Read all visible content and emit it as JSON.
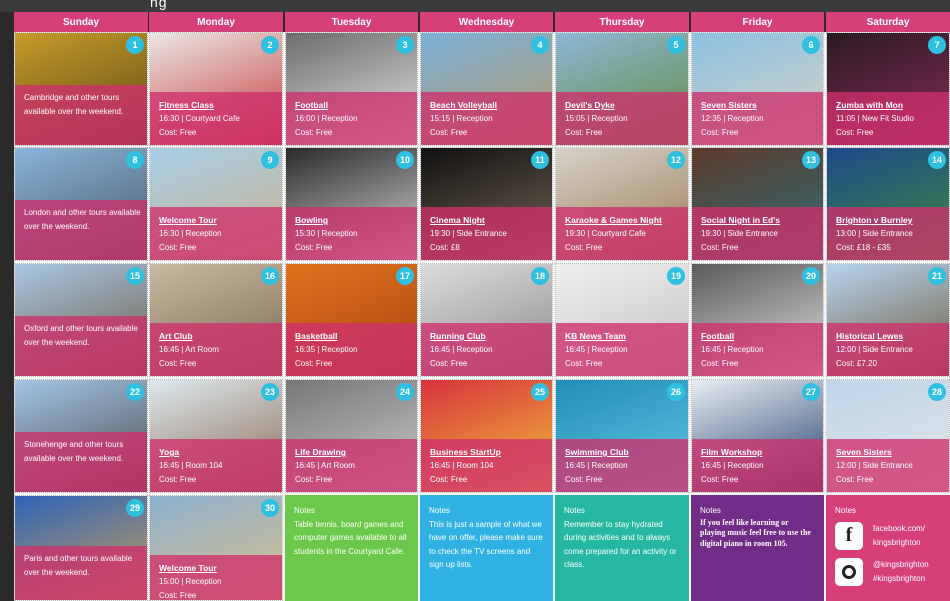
{
  "window_title": "ng",
  "days": [
    "Sunday",
    "Monday",
    "Tuesday",
    "Wednesday",
    "Thursday",
    "Friday",
    "Saturday"
  ],
  "rows": [
    [
      {
        "num": "1",
        "type": "tour",
        "text": "Cambridge and other tours available over the weekend."
      },
      {
        "num": "2",
        "type": "event",
        "title": "Fitness Class",
        "line": "16:30 | Courtyard Cafe",
        "cost": "Cost: Free"
      },
      {
        "num": "3",
        "type": "event",
        "title": "Football",
        "line": "16:00 | Reception",
        "cost": "Cost: Free"
      },
      {
        "num": "4",
        "type": "event",
        "title": "Beach Volleyball",
        "line": "15:15 | Reception",
        "cost": "Cost: Free"
      },
      {
        "num": "5",
        "type": "event",
        "title": "Devil's Dyke",
        "line": "15:05 | Reception",
        "cost": "Cost: Free"
      },
      {
        "num": "6",
        "type": "event",
        "title": "Seven Sisters",
        "line": "12:35 | Reception",
        "cost": "Cost: Free"
      },
      {
        "num": "7",
        "type": "event",
        "title": "Zumba with Mon",
        "line": "11:05 | New Fit Studio",
        "cost": "Cost: Free"
      }
    ],
    [
      {
        "num": "8",
        "type": "tour",
        "text": "London and other tours available over the weekend."
      },
      {
        "num": "9",
        "type": "event",
        "title": "Welcome Tour",
        "line": "16:30 | Reception",
        "cost": "Cost: Free"
      },
      {
        "num": "10",
        "type": "event",
        "title": "Bowling",
        "line": "15:30 | Reception",
        "cost": "Cost: Free"
      },
      {
        "num": "11",
        "type": "event",
        "title": "Cinema Night",
        "line": "19:30 | Side Entrance",
        "cost": "Cost: £8"
      },
      {
        "num": "12",
        "type": "event",
        "title": "Karaoke & Games Night",
        "line": "19:30 | Courtyard Cafe",
        "cost": "Cost: Free"
      },
      {
        "num": "13",
        "type": "event",
        "title": "Social Night in Ed's",
        "line": "19:30 | Side Entrance",
        "cost": "Cost: Free"
      },
      {
        "num": "14",
        "type": "event",
        "title": "Brighton v Burnley",
        "line": "13:00 | Side Entrance",
        "cost": "Cost: £18 - £35"
      }
    ],
    [
      {
        "num": "15",
        "type": "tour",
        "text": "Oxford and other tours available over the weekend."
      },
      {
        "num": "16",
        "type": "event",
        "title": "Art Club",
        "line": "16:45 | Art Room",
        "cost": "Cost: Free"
      },
      {
        "num": "17",
        "type": "event",
        "title": "Basketball",
        "line": "16:35 | Reception",
        "cost": "Cost: Free"
      },
      {
        "num": "18",
        "type": "event",
        "title": "Running Club",
        "line": "16:45 | Reception",
        "cost": "Cost: Free"
      },
      {
        "num": "19",
        "type": "event",
        "title": "KB News Team",
        "line": "16:45 | Reception",
        "cost": "Cost: Free"
      },
      {
        "num": "20",
        "type": "event",
        "title": "Football",
        "line": "16:45 | Reception",
        "cost": "Cost: Free"
      },
      {
        "num": "21",
        "type": "event",
        "title": "Historical Lewes",
        "line": "12:00 | Side Entrance",
        "cost": "Cost: £7.20"
      }
    ],
    [
      {
        "num": "22",
        "type": "tour",
        "text": "Stonehenge and other tours available over the weekend."
      },
      {
        "num": "23",
        "type": "event",
        "title": "Yoga",
        "line": "16:45 | Room 104",
        "cost": "Cost: Free"
      },
      {
        "num": "24",
        "type": "event",
        "title": "Life Drawing",
        "line": "16:45 | Art Room",
        "cost": "Cost: Free"
      },
      {
        "num": "25",
        "type": "event",
        "title": "Business StartUp",
        "line": "16:45 | Room 104",
        "cost": "Cost: Free"
      },
      {
        "num": "26",
        "type": "event",
        "title": "Swimming Club",
        "line": "16:45 | Reception",
        "cost": "Cost: Free"
      },
      {
        "num": "27",
        "type": "event",
        "title": "Film Workshop",
        "line": "16:45 | Reception",
        "cost": "Cost: Free"
      },
      {
        "num": "28",
        "type": "event",
        "title": "Seven Sisters",
        "line": "12:00 | Side Entrance",
        "cost": "Cost: Free"
      }
    ]
  ],
  "last_row": {
    "sun": {
      "num": "29",
      "text": "Paris and other tours available over the weekend."
    },
    "mon": {
      "num": "30",
      "title": "Welcome Tour",
      "line": "15:00 | Reception",
      "cost": "Cost: Free"
    },
    "notes": [
      {
        "heading": "Notes",
        "text": "Table tennis, board games and computer games available to all students in the Courtyard Cafe.",
        "color": "#6bc84a"
      },
      {
        "heading": "Notes",
        "text": "This is just a sample of what we have on offer, please make sure to check the TV screens and sign up lists.",
        "color": "#2fb2e3"
      },
      {
        "heading": "Notes",
        "text": "Remember to stay hydrated during activities and to always come prepared for an activity or class.",
        "color": "#26b7a1"
      },
      {
        "heading": "Notes",
        "text": "If you feel like learning or playing music feel free to use the digital piano in room 105.",
        "color": "#702c86"
      }
    ],
    "social": {
      "heading": "Notes",
      "facebook": "facebook.com/ kingsbrighton",
      "instagram": "@kingsbrighton #kingsbrighton",
      "color": "#d63f78"
    }
  },
  "colors": {
    "header": "#d63f78",
    "badge": "#2fc0e0",
    "overlay": "#ce306c"
  },
  "image_palettes": [
    [
      "#c79a2a",
      "#5b4a12"
    ],
    [
      "#e9e6e2",
      "#c73b3b"
    ],
    [
      "#6c6c6c",
      "#e8e8e8"
    ],
    [
      "#7bb0d8",
      "#b59a6a"
    ],
    [
      "#8fb7d6",
      "#5f8a3b"
    ],
    [
      "#8cc0e0",
      "#d7d3c6"
    ],
    [
      "#2a1b22",
      "#8a2b5c"
    ],
    [
      "#8ab5d9",
      "#4a5566"
    ],
    [
      "#a9cfe8",
      "#c7b08c"
    ],
    [
      "#2a2a2a",
      "#d9d9d9"
    ],
    [
      "#111",
      "#776655"
    ],
    [
      "#d7d2c8",
      "#9a7b55"
    ],
    [
      "#5c3a2a",
      "#2e6f7a"
    ],
    [
      "#1d4a8a",
      "#3e8a3e"
    ],
    [
      "#a9c7e2",
      "#6a5a44"
    ],
    [
      "#c8b9a0",
      "#7a6a52"
    ],
    [
      "#e0731f",
      "#a8430d"
    ],
    [
      "#dcdcdc",
      "#8a8a8a"
    ],
    [
      "#f0f0f0",
      "#c0c0c0"
    ],
    [
      "#5a5a5a",
      "#e2e2e2"
    ],
    [
      "#b7d4ee",
      "#6d5a3c"
    ],
    [
      "#a3c5e6",
      "#4a4a4a"
    ],
    [
      "#dde8ee",
      "#8a6a52"
    ],
    [
      "#777",
      "#ccc"
    ],
    [
      "#d7323c",
      "#f2c23a"
    ],
    [
      "#1f8fb6",
      "#67c4e8"
    ],
    [
      "#e8eef2",
      "#1e3c6a"
    ],
    [
      "#bcd6ea",
      "#e6e6e6"
    ],
    [
      "#2d63b8",
      "#caa15a"
    ],
    [
      "#8cb0cf",
      "#d9c08a"
    ]
  ]
}
